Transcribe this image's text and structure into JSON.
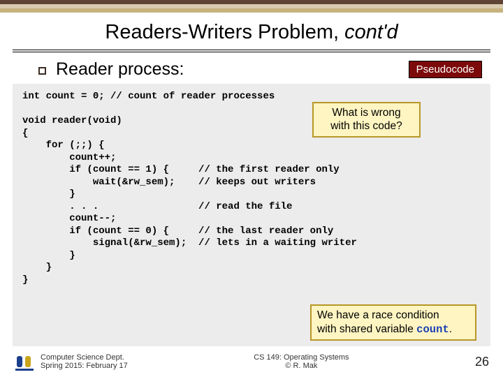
{
  "title_main": "Readers-Writers Problem, ",
  "title_italic": "cont'd",
  "section_heading": "Reader process:",
  "badge": "Pseudocode",
  "code_line_1": "int count = 0; // count of reader processes",
  "code_block": "void reader(void)\n{\n    for (;;) {\n        count++;\n        if (count == 1) {     // the first reader only\n            wait(&rw_sem);    // keeps out writers\n        }\n        . . .                 // read the file\n        count--;\n        if (count == 0) {     // the last reader only\n            signal(&rw_sem);  // lets in a waiting writer\n        }\n    }\n}",
  "callout_top_l1": "What is wrong",
  "callout_top_l2": "with this code?",
  "callout_bot_l1": "We have a race condition",
  "callout_bot_l2_a": "with shared variable ",
  "callout_bot_l2_b": "count",
  "callout_bot_l2_c": ".",
  "footer_dept": "Computer Science Dept.",
  "footer_date": "Spring 2015: February 17",
  "footer_course": "CS 149: Operating Systems",
  "footer_author": "© R. Mak",
  "page_num": "26"
}
